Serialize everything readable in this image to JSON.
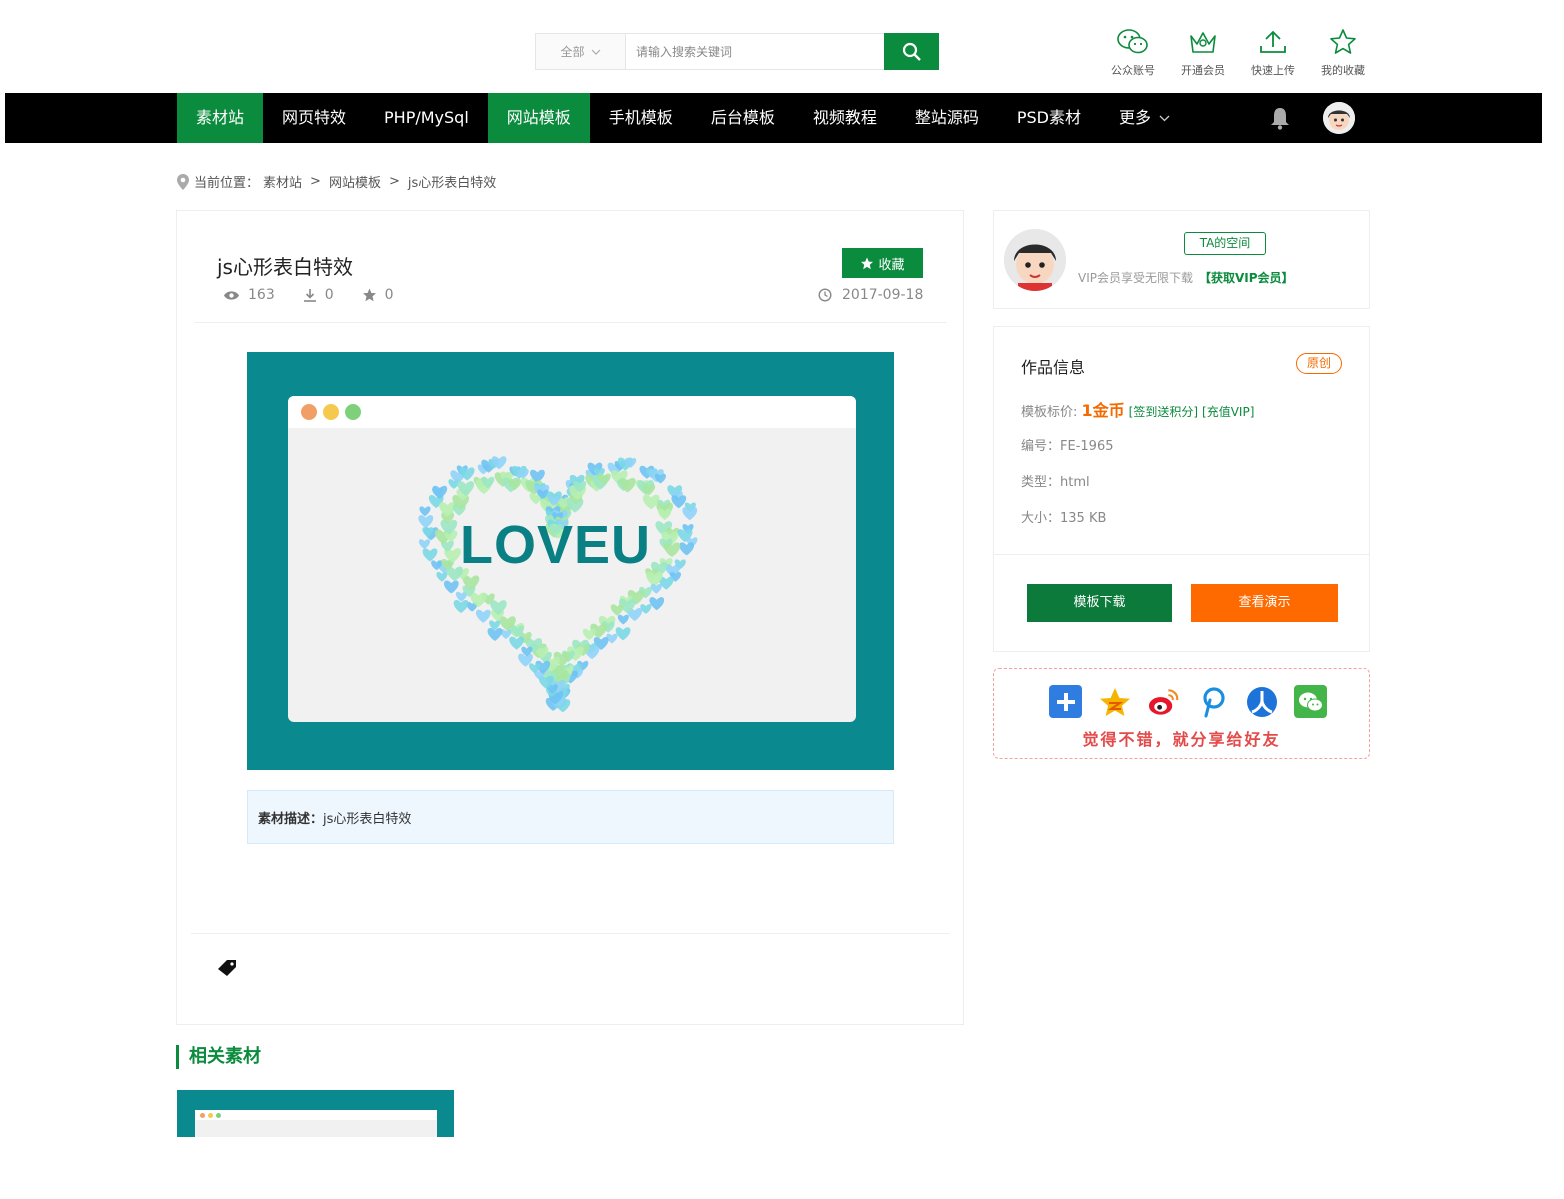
{
  "search": {
    "scope": "全部",
    "placeholder": "请输入搜索关键词"
  },
  "quick_links": [
    {
      "label": "公众账号",
      "icon": "wechat-icon"
    },
    {
      "label": "开通会员",
      "icon": "crown-icon"
    },
    {
      "label": "快速上传",
      "icon": "upload-icon"
    },
    {
      "label": "我的收藏",
      "icon": "star-icon"
    }
  ],
  "nav": {
    "items": [
      {
        "label": "素材站"
      },
      {
        "label": "网页特效"
      },
      {
        "label": "PHP/MySql"
      },
      {
        "label": "网站模板"
      },
      {
        "label": "手机模板"
      },
      {
        "label": "后台模板"
      },
      {
        "label": "视频教程"
      },
      {
        "label": "整站源码"
      },
      {
        "label": "PSD素材"
      },
      {
        "label": "更多"
      }
    ]
  },
  "breadcrumb": {
    "prefix": "当前位置：",
    "items": [
      "素材站",
      "网站模板",
      "js心形表白特效"
    ],
    "sep": ">"
  },
  "detail": {
    "title": "js心形表白特效",
    "views": "163",
    "downloads": "0",
    "favorites": "0",
    "fav_label": "收藏",
    "date": "2017-09-18",
    "preview_text": "LOVEU",
    "desc_label": "素材描述：",
    "desc_text": "js心形表白特效"
  },
  "related": {
    "title": "相关素材"
  },
  "user": {
    "ta_label": "TA的空间",
    "vip_text": "VIP会员享受无限下载",
    "vip_link": "【获取VIP会员】"
  },
  "info": {
    "title": "作品信息",
    "badge": "原创",
    "price_label": "模板标价: ",
    "price": "1金币",
    "sign_link": "[签到送积分]",
    "vip_link": "[充值VIP]",
    "code_label": "编号：",
    "code": "FE-1965",
    "type_label": "类型：",
    "type": "html",
    "size_label": "大小：",
    "size": "135 KB",
    "download_label": "模板下载",
    "demo_label": "查看演示"
  },
  "share": {
    "text": "觉得不错，就分享给好友",
    "icons": [
      "plus-share-icon",
      "qzone-icon",
      "weibo-icon",
      "pinterest-icon",
      "renren-icon",
      "wechat-share-icon"
    ]
  },
  "colors": {
    "brand": "#0b8b3d",
    "orange": "#ff6a00",
    "preview_bg": "#0a898e"
  }
}
